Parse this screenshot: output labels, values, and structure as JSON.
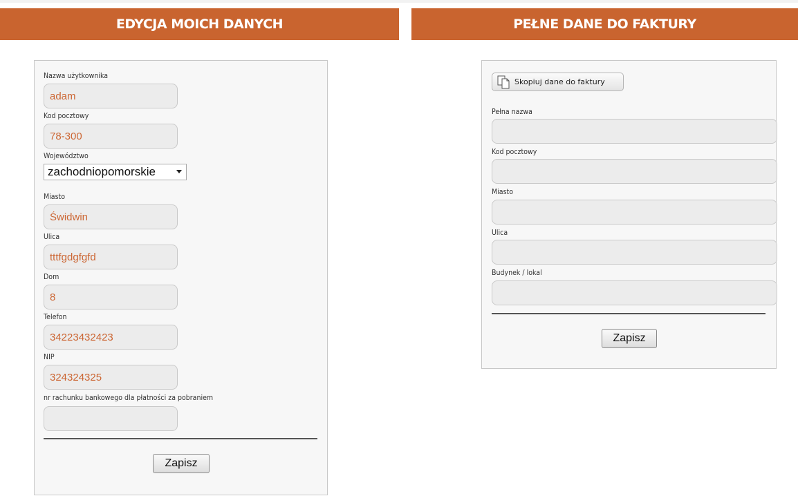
{
  "left_section": {
    "header": "EDYCJA MOICH DANYCH",
    "fields": {
      "username": {
        "label": "Nazwa użytkownika",
        "value": "adam"
      },
      "postal_code": {
        "label": "Kod pocztowy",
        "value": "78-300"
      },
      "voivodeship": {
        "label": "Województwo",
        "value": "zachodniopomorskie"
      },
      "city": {
        "label": "Miasto",
        "value": "Świdwin"
      },
      "street": {
        "label": "Ulica",
        "value": "tttfgdgfgfd"
      },
      "house": {
        "label": "Dom",
        "value": "8"
      },
      "phone": {
        "label": "Telefon",
        "value": "34223432423"
      },
      "nip": {
        "label": "NIP",
        "value": "324324325"
      },
      "bank_account": {
        "label": "nr rachunku bankowego dla płatności za pobraniem",
        "value": ""
      }
    },
    "save_label": "Zapisz"
  },
  "right_section": {
    "header": "PEŁNE DANE DO FAKTURY",
    "copy_button_label": "Skopiuj dane do faktury",
    "fields": {
      "full_name": {
        "label": "Pełna nazwa",
        "value": ""
      },
      "postal_code": {
        "label": "Kod pocztowy",
        "value": ""
      },
      "city": {
        "label": "Miasto",
        "value": ""
      },
      "street": {
        "label": "Ulica",
        "value": ""
      },
      "building": {
        "label": "Budynek / lokal",
        "value": ""
      }
    },
    "save_label": "Zapisz"
  },
  "icons": {
    "copy": "copy-documents-icon",
    "dropdown": "chevron-down-icon"
  },
  "colors": {
    "header_bg": "#c9642f",
    "input_text": "#cc6633",
    "panel_bg": "#f7f7f7"
  }
}
